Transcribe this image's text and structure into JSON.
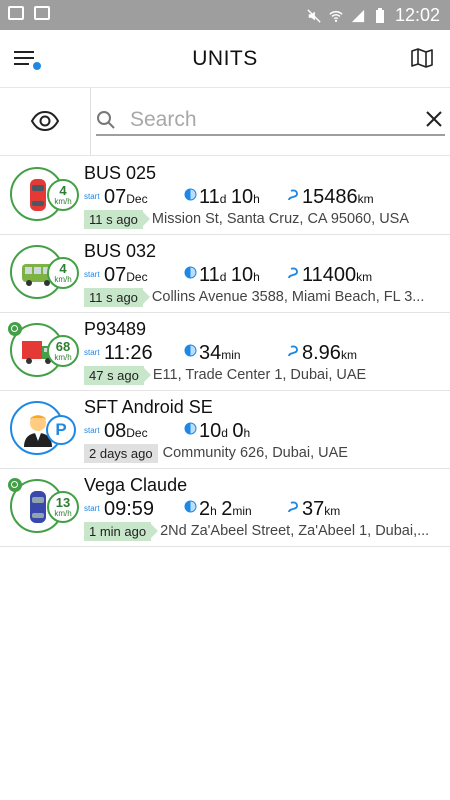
{
  "status_bar": {
    "time": "12:02"
  },
  "header": {
    "title": "UNITS"
  },
  "search": {
    "placeholder": "Search",
    "value": ""
  },
  "units": [
    {
      "name": "BUS 025",
      "speed": "4",
      "speed_unit": "km/h",
      "start_label": "start",
      "start_value": "07",
      "start_unit": "Dec",
      "duration_1": "11",
      "duration_1_unit": "d",
      "duration_2": "10",
      "duration_2_unit": "h",
      "distance": "15486",
      "distance_unit": "km",
      "ago": "11 s ago",
      "address": "Mission St, Santa Cruz, CA 95060, USA",
      "icon": "red-car-icon"
    },
    {
      "name": "BUS 032",
      "speed": "4",
      "speed_unit": "km/h",
      "start_label": "start",
      "start_value": "07",
      "start_unit": "Dec",
      "duration_1": "11",
      "duration_1_unit": "d",
      "duration_2": "10",
      "duration_2_unit": "h",
      "distance": "11400",
      "distance_unit": "km",
      "ago": "11 s ago",
      "address": "Collins Avenue 3588, Miami Beach, FL 3...",
      "icon": "green-bus-icon"
    },
    {
      "name": "P93489",
      "speed": "68",
      "speed_unit": "km/h",
      "start_label": "start",
      "start_value": "11:26",
      "start_unit": "",
      "duration_1": "34",
      "duration_1_unit": "min",
      "duration_2": "",
      "duration_2_unit": "",
      "distance": "8.96",
      "distance_unit": "km",
      "ago": "47 s ago",
      "address": "E11, Trade Center 1, Dubai, UAE",
      "icon": "red-truck-icon"
    },
    {
      "name": "SFT Android SE",
      "parked_label": "P",
      "start_label": "start",
      "start_value": "08",
      "start_unit": "Dec",
      "duration_1": "10",
      "duration_1_unit": "d",
      "duration_2": "0",
      "duration_2_unit": "h",
      "distance": "",
      "distance_unit": "",
      "ago": "2 days ago",
      "address": "Community 626, Dubai, UAE",
      "icon": "person-avatar-icon"
    },
    {
      "name": "Vega Claude",
      "speed": "13",
      "speed_unit": "km/h",
      "start_label": "start",
      "start_value": "09:59",
      "start_unit": "",
      "duration_1": "2",
      "duration_1_unit": "h",
      "duration_2": "2",
      "duration_2_unit": "min",
      "distance": "37",
      "distance_unit": "km",
      "ago": "1 min ago",
      "address": "2Nd Za'Abeel Street, Za'Abeel 1, Dubai,...",
      "icon": "blue-car-icon"
    }
  ],
  "colors": {
    "accent_blue": "#1e88e5",
    "moving_green": "#43a047",
    "ago_green_bg": "#c8e6c9",
    "ago_grey_bg": "#e0e0e0",
    "status_bar": "#9e9e9e"
  }
}
